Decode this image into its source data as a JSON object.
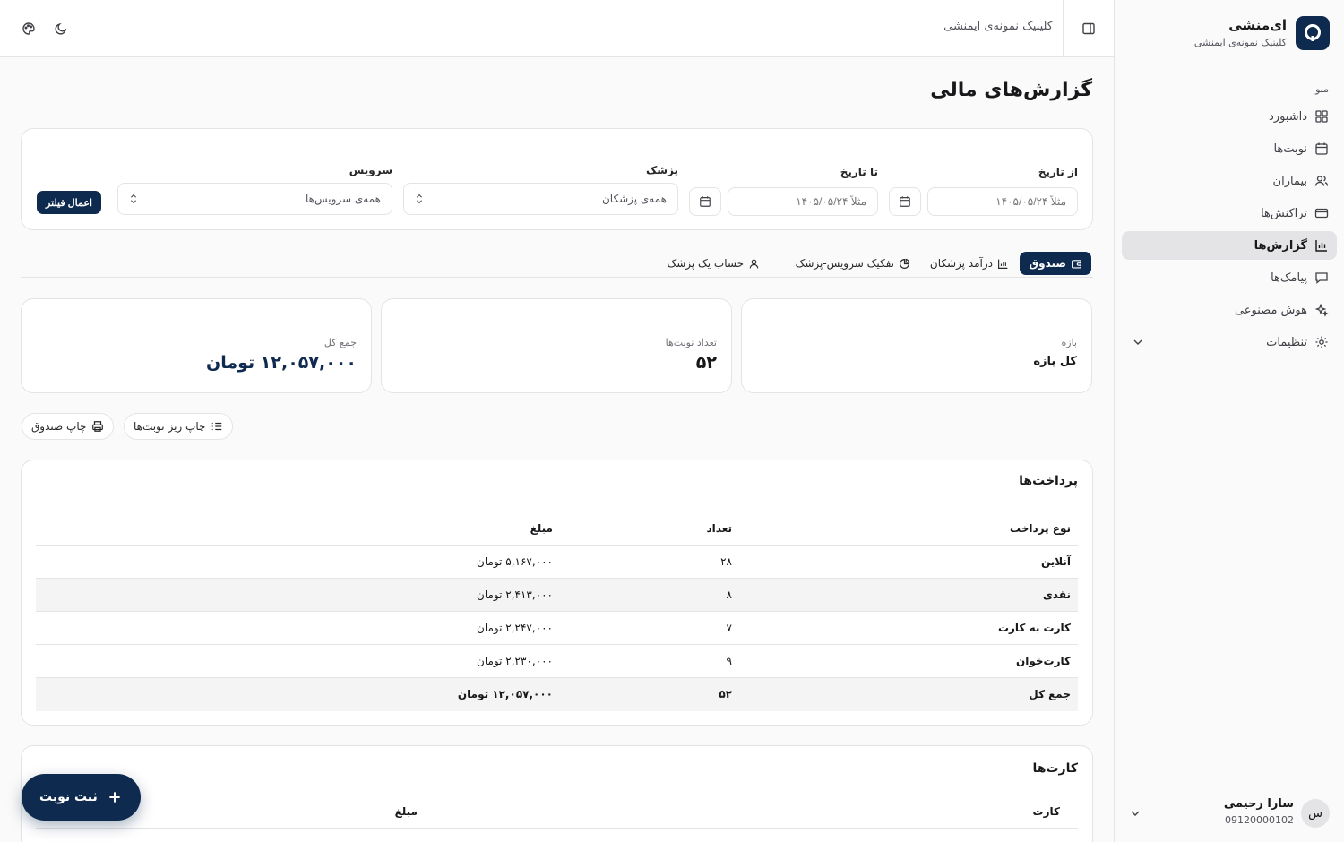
{
  "brand": {
    "name": "ای‌منشی",
    "clinic": "کلینیک نمونه‌ی ایمنشی"
  },
  "sidebar": {
    "menu_label": "منو",
    "items": [
      {
        "label": "داشبورد",
        "icon": "dashboard-icon"
      },
      {
        "label": "نوبت‌ها",
        "icon": "calendar-icon"
      },
      {
        "label": "بیماران",
        "icon": "users-icon"
      },
      {
        "label": "تراکنش‌ها",
        "icon": "credit-card-icon"
      },
      {
        "label": "گزارش‌ها",
        "icon": "bar-chart-icon",
        "active": true
      },
      {
        "label": "پیامک‌ها",
        "icon": "message-icon"
      },
      {
        "label": "هوش مصنوعی",
        "icon": "sparkles-icon"
      },
      {
        "label": "تنظیمات",
        "icon": "gear-icon"
      }
    ],
    "user": {
      "initial": "س",
      "name": "سارا رحیمی",
      "phone": "09120000102"
    }
  },
  "topbar": {
    "clinic": "کلینیک نمونه‌ی ایمنشی"
  },
  "page": {
    "title": "گزارش‌های مالی"
  },
  "filters": {
    "from_label": "از تاریخ",
    "from_placeholder": "مثلاً ۱۴۰۵/۰۵/۲۴",
    "to_label": "تا تاریخ",
    "to_placeholder": "مثلاً ۱۴۰۵/۰۵/۲۴",
    "doctor_label": "پزشک",
    "doctor_value": "همه‌ی پزشکان",
    "service_label": "سرویس",
    "service_value": "همه‌ی سرویس‌ها",
    "apply": "اعمال فیلتر"
  },
  "tabs": [
    {
      "label": "صندوق",
      "active": true
    },
    {
      "label": "درآمد پزشکان"
    },
    {
      "label": "تفکیک سرویس-پزشک"
    },
    {
      "label": "حساب یک پزشک"
    }
  ],
  "stats": {
    "range_label": "بازه",
    "range_value": "کل بازه",
    "count_label": "تعداد نوبت‌ها",
    "count_value": "۵۲",
    "total_label": "جمع کل",
    "total_value": "۱۲,۰۵۷,۰۰۰ تومان"
  },
  "actions": {
    "print_box": "چاپ صندوق",
    "print_detail": "چاپ ریز نوبت‌ها"
  },
  "payments": {
    "title": "پرداخت‌ها",
    "headers": {
      "type": "نوع پرداخت",
      "count": "تعداد",
      "amount": "مبلغ"
    },
    "rows": [
      {
        "type": "آنلاین",
        "count": "۲۸",
        "amount": "۵,۱۶۷,۰۰۰ تومان"
      },
      {
        "type": "نقدی",
        "count": "۸",
        "amount": "۲,۴۱۳,۰۰۰ تومان"
      },
      {
        "type": "کارت به کارت",
        "count": "۷",
        "amount": "۲,۲۴۷,۰۰۰ تومان"
      },
      {
        "type": "کارت‌خوان",
        "count": "۹",
        "amount": "۲,۲۳۰,۰۰۰ تومان"
      }
    ],
    "total": {
      "type": "جمع کل",
      "count": "۵۲",
      "amount": "۱۲,۰۵۷,۰۰۰ تومان"
    }
  },
  "cards": {
    "title": "کارت‌ها",
    "headers": {
      "card": "کارت",
      "amount": "مبلغ"
    }
  },
  "fab": {
    "label": "ثبت نوبت"
  },
  "colors": {
    "primary": "#0f2a4f",
    "border": "#e4e4e7",
    "background": "#fafafa"
  }
}
